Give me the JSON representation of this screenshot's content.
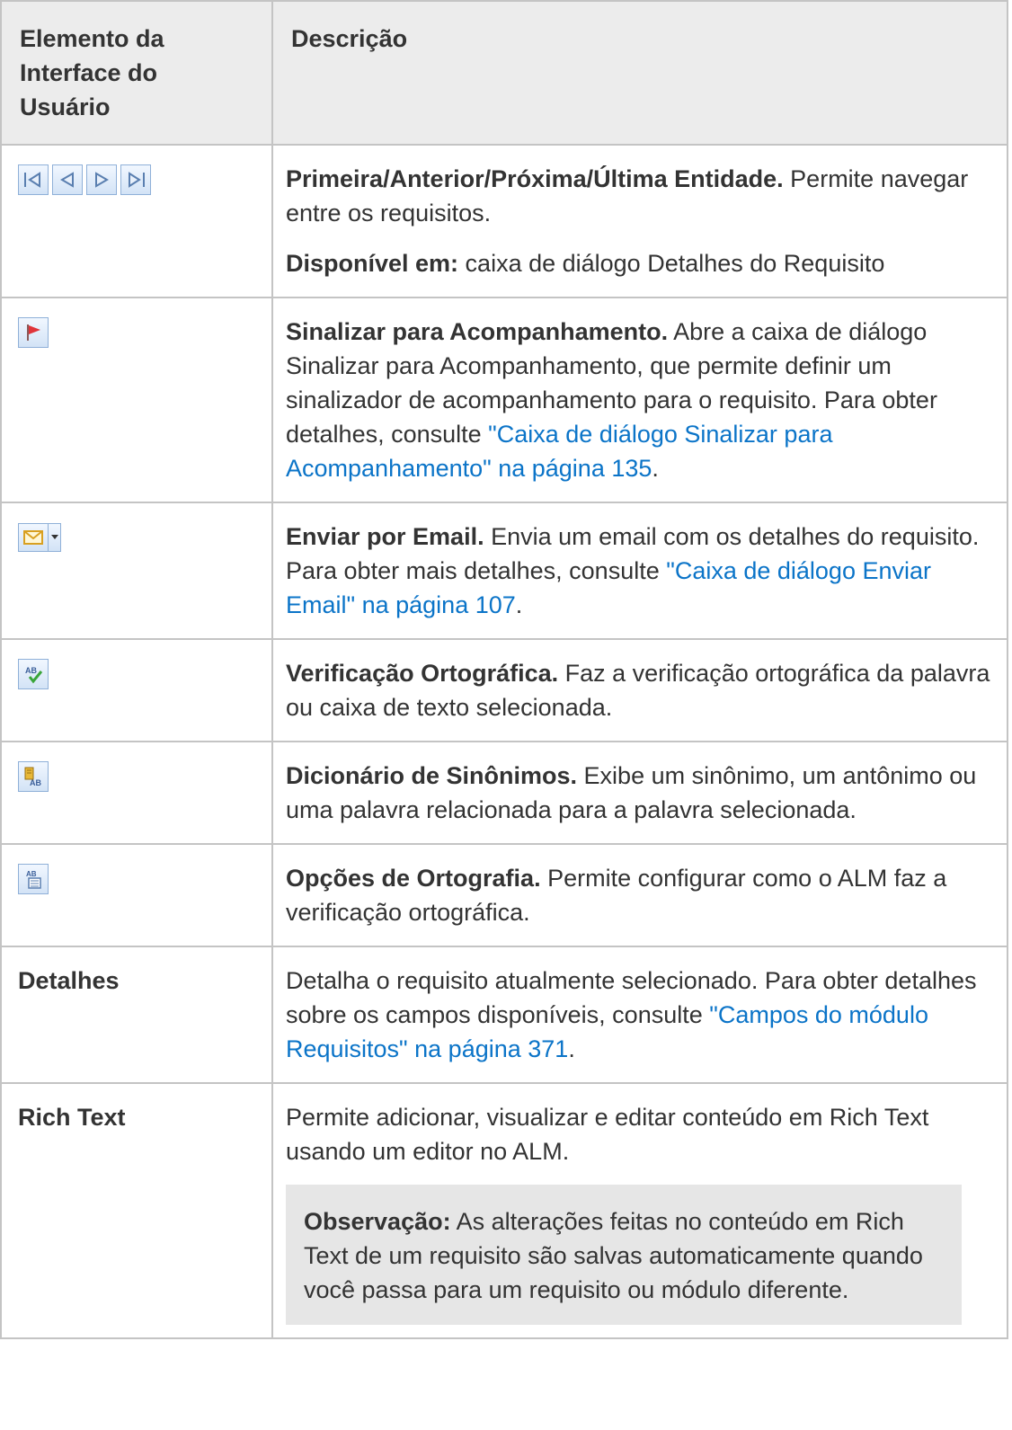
{
  "header": {
    "col1": "Elemento da Interface do Usuário",
    "col2": "Descrição"
  },
  "rows": {
    "nav": {
      "icons": [
        "first-entity-icon",
        "previous-entity-icon",
        "next-entity-icon",
        "last-entity-icon"
      ],
      "title": "Primeira/Anterior/Próxima/Última Entidade.",
      "text": " Permite navegar entre os requisitos.",
      "avail_label": "Disponível em:",
      "avail_text": " caixa de diálogo Detalhes do Requisito"
    },
    "flag": {
      "icon": "flag-icon",
      "title": "Sinalizar para Acompanhamento.",
      "text": " Abre a caixa de diálogo Sinalizar para Acompanhamento, que permite definir um sinalizador de acompanhamento para o requisito. Para obter detalhes, consulte ",
      "link": "\"Caixa de diálogo Sinalizar para Acompanhamento\" na página 135",
      "after": "."
    },
    "email": {
      "icon": "email-icon",
      "title": "Enviar por Email.",
      "text": " Envia um email com os detalhes do requisito. Para obter mais detalhes, consulte ",
      "link": "\"Caixa de diálogo Enviar Email\" na página 107",
      "after": "."
    },
    "spell": {
      "icon": "spell-check-icon",
      "title": "Verificação Ortográfica.",
      "text": " Faz a verificação ortográfica da palavra ou caixa de texto selecionada."
    },
    "thesaurus": {
      "icon": "thesaurus-icon",
      "title": "Dicionário de Sinônimos.",
      "text": " Exibe um sinônimo, um antônimo ou uma palavra relacionada para a palavra selecionada."
    },
    "spell_options": {
      "icon": "spelling-options-icon",
      "title": "Opções de Ortografia.",
      "text": " Permite configurar como o ALM faz a verificação ortográfica."
    },
    "details": {
      "label": "Detalhes",
      "text": "Detalha o requisito atualmente selecionado. Para obter detalhes sobre os campos disponíveis, consulte ",
      "link": "\"Campos do módulo Requisitos\" na página 371",
      "after": "."
    },
    "rich_text": {
      "label": "Rich Text",
      "text": "Permite adicionar, visualizar e editar conteúdo em Rich Text usando um editor no ALM.",
      "note_label": "Observação:",
      "note_text": " As alterações feitas no conteúdo em Rich Text de um requisito são salvas automaticamente quando você passa para um requisito ou módulo diferente."
    }
  }
}
